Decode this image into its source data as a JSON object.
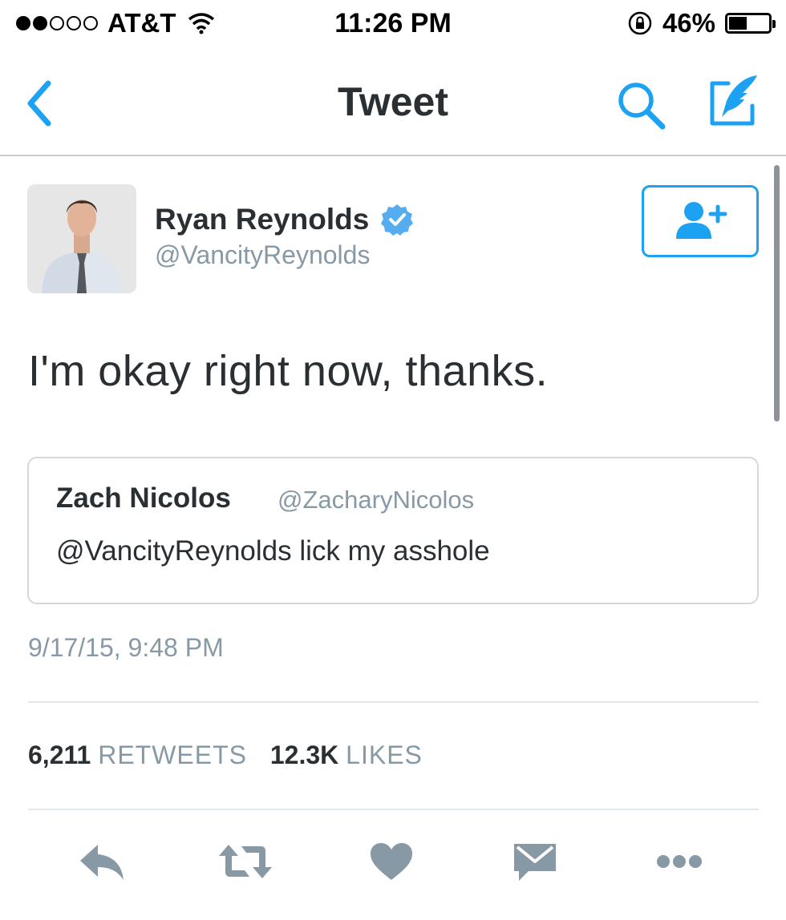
{
  "status_bar": {
    "carrier": "AT&T",
    "time": "11:26 PM",
    "battery_percent": "46%",
    "battery_level": 0.46,
    "signal_bars_filled": 2,
    "signal_bars_total": 5
  },
  "nav": {
    "title": "Tweet",
    "back_icon": "chevron-left-icon",
    "search_icon": "search-icon",
    "compose_icon": "compose-quill-icon"
  },
  "tweet": {
    "author_name": "Ryan Reynolds",
    "author_handle": "@VancityReynolds",
    "verified": true,
    "text": "I'm okay right now, thanks.",
    "quoted": {
      "author_name": "Zach Nicolos",
      "author_handle": "@ZacharyNicolos",
      "text": "@VancityReynolds lick my asshole"
    },
    "timestamp": "9/17/15, 9:48 PM",
    "retweets_count": "6,211",
    "retweets_label": "RETWEETS",
    "likes_count": "12.3K",
    "likes_label": "LIKES"
  },
  "actions": [
    "reply-icon",
    "retweet-icon",
    "like-icon",
    "direct-message-icon",
    "more-icon"
  ],
  "colors": {
    "accent": "#1da1f2",
    "text": "#292f33",
    "secondary": "#8899a6",
    "action_icon": "#8899a6"
  }
}
